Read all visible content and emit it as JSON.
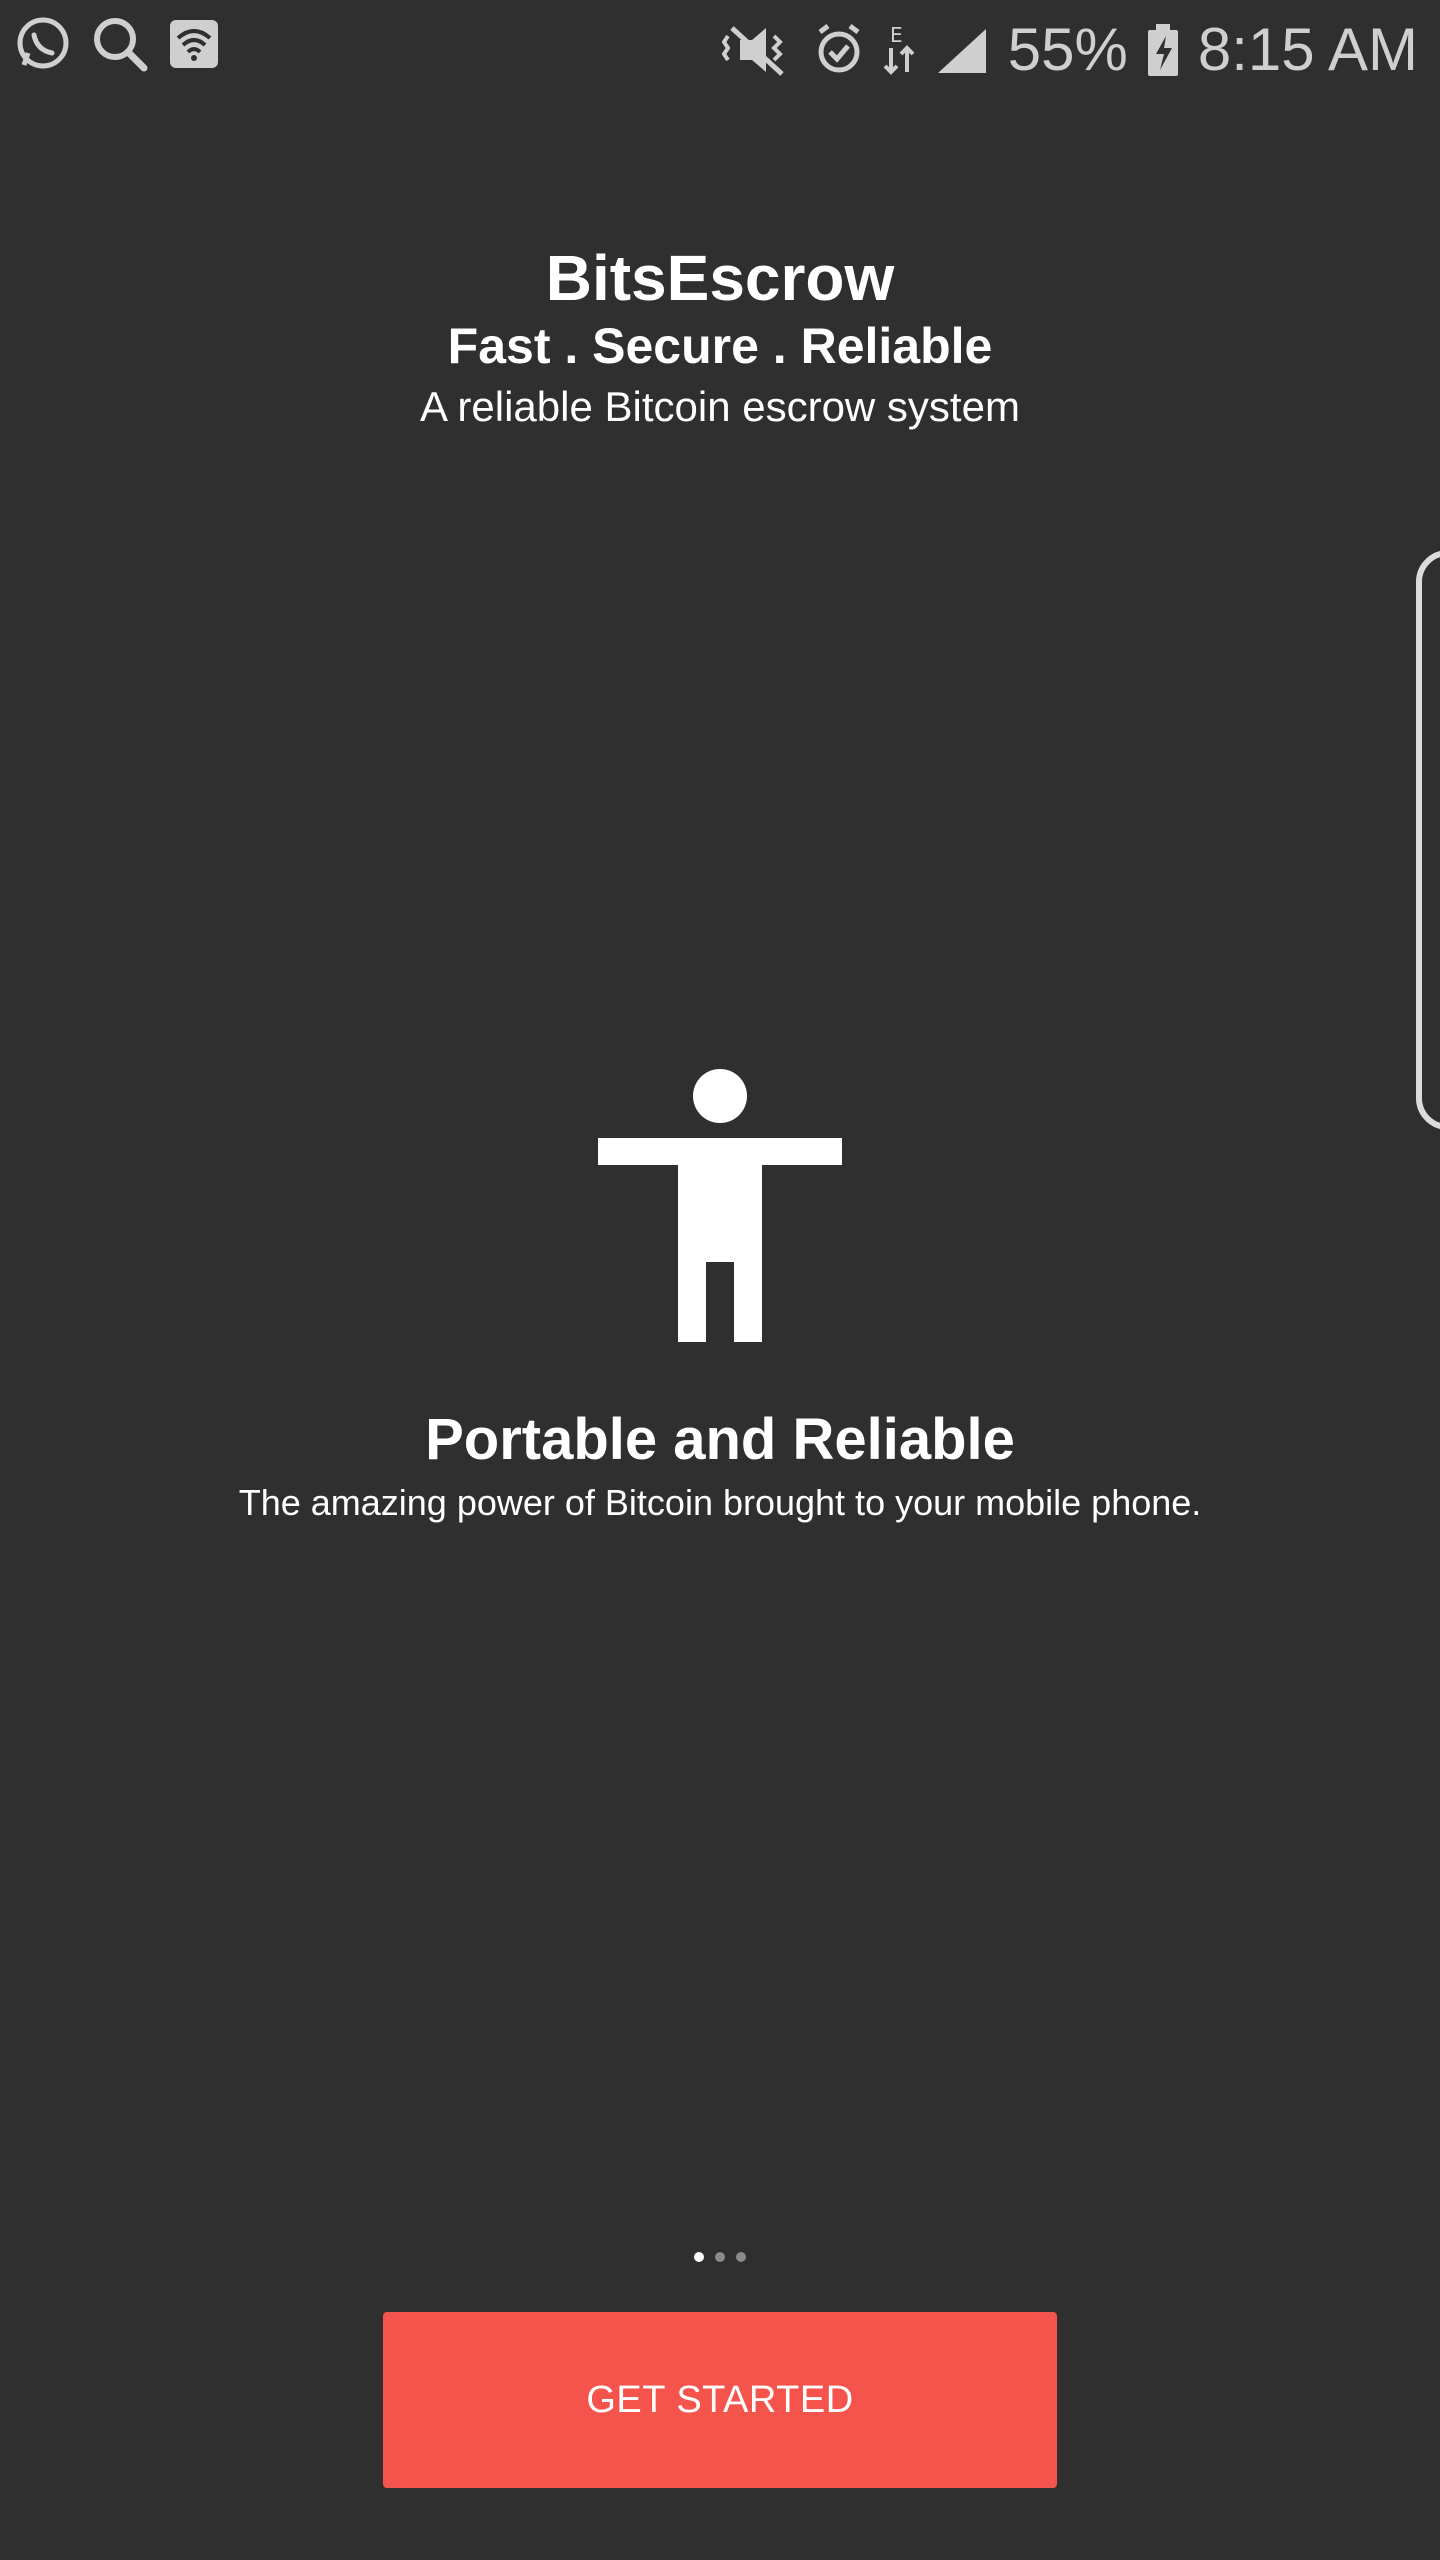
{
  "status_bar": {
    "battery": "55%",
    "time": "8:15 AM",
    "left_icons": [
      "whatsapp-icon",
      "search-icon",
      "wifi-icon"
    ],
    "right_icons": [
      "mute-icon",
      "alarm-icon",
      "data-arrows-icon",
      "signal-icon",
      "battery-charging-icon"
    ]
  },
  "hero": {
    "title": "BitsEscrow",
    "tagline": "Fast . Secure . Reliable",
    "subtitle": "A reliable Bitcoin escrow system"
  },
  "feature": {
    "icon": "person-standing-icon",
    "title": "Portable and Reliable",
    "description": "The amazing power of Bitcoin brought to your mobile phone."
  },
  "pager": {
    "count": 3,
    "active_index": 0
  },
  "cta": {
    "label": "GET STARTED"
  },
  "colors": {
    "background": "#2f2f2f",
    "accent": "#f5544c",
    "text": "#ffffff"
  }
}
